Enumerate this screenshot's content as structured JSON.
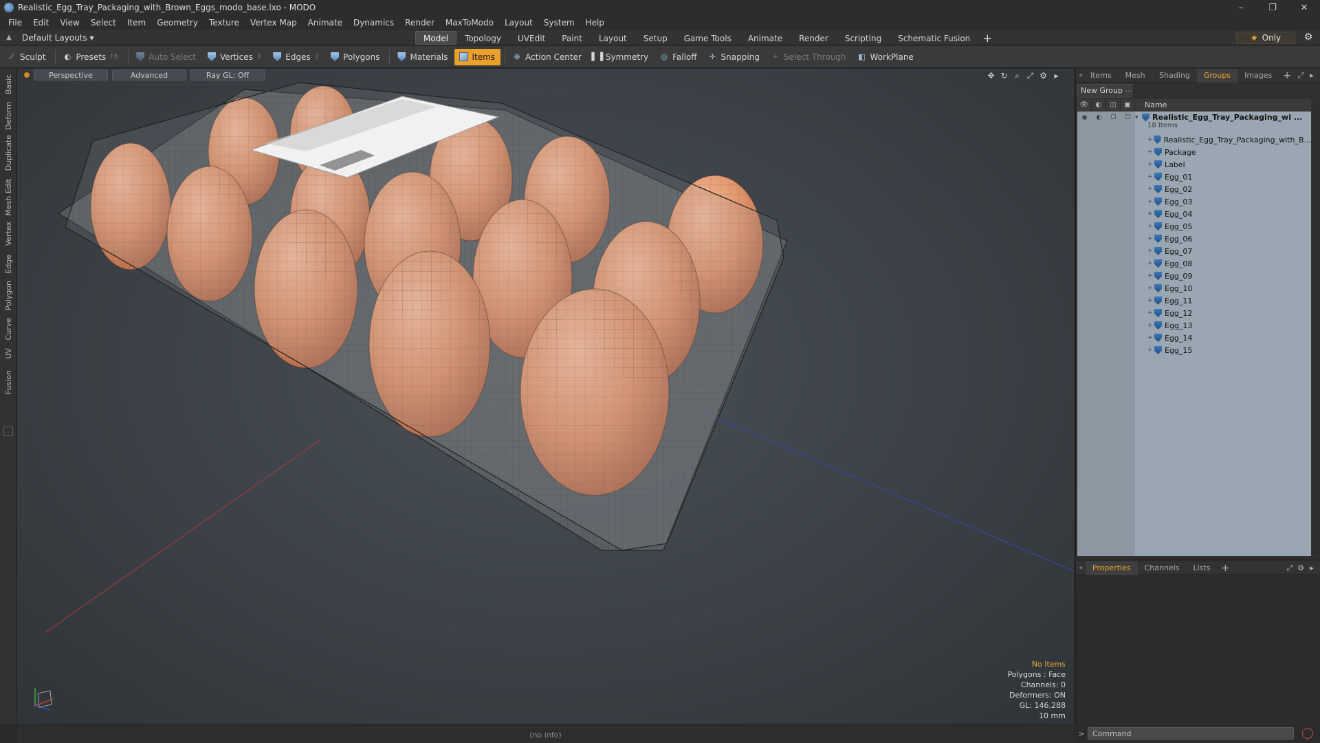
{
  "window": {
    "title": "Realistic_Egg_Tray_Packaging_with_Brown_Eggs_modo_base.lxo - MODO",
    "minimize": "–",
    "restore": "❐",
    "close": "✕"
  },
  "menu": [
    "File",
    "Edit",
    "View",
    "Select",
    "Item",
    "Geometry",
    "Texture",
    "Vertex Map",
    "Animate",
    "Dynamics",
    "Render",
    "MaxToModo",
    "Layout",
    "System",
    "Help"
  ],
  "layout_bar": {
    "layout_name": "Default Layouts ▾",
    "tabs": [
      "Model",
      "Topology",
      "UVEdit",
      "Paint",
      "Layout",
      "Setup",
      "Game Tools",
      "Animate",
      "Render",
      "Scripting",
      "Schematic Fusion"
    ],
    "active_tab": "Model",
    "add_tab": "+",
    "only_label": "Only"
  },
  "toolbar": {
    "sculpt": "Sculpt",
    "presets": "Presets",
    "presets_key": "F6",
    "auto_select": "Auto Select",
    "vertices": "Vertices",
    "vertices_key": "1",
    "edges": "Edges",
    "edges_key": "2",
    "polygons": "Polygons",
    "materials": "Materials",
    "items": "Items",
    "action_center": "Action Center",
    "symmetry": "Symmetry",
    "falloff": "Falloff",
    "snapping": "Snapping",
    "select_through": "Select Through",
    "workplane": "WorkPlane"
  },
  "left_tabs": [
    "Basic",
    "Deform",
    "Duplicate",
    "Mesh Edit",
    "Vertex",
    "Edge",
    "Polygon",
    "Curve",
    "UV",
    "Fusion"
  ],
  "viewport": {
    "view_mode": "Perspective",
    "shading": "Advanced",
    "raygl": "Ray GL: Off",
    "info": {
      "selection": "No Items",
      "polygons": "Polygons : Face",
      "channels": "Channels: 0",
      "deformers": "Deformers: ON",
      "gl": "GL: 146,288",
      "scale": "10 mm"
    }
  },
  "status_bar": "(no info)",
  "right_panel": {
    "top_tabs": [
      "Items",
      "Mesh ...",
      "Shading",
      "Groups",
      "Images"
    ],
    "active_top_tab": "Groups",
    "new_group": "New Group",
    "name_header": "Name",
    "root": {
      "name": "Realistic_Egg_Tray_Packaging_wi ...",
      "count": "18 Items"
    },
    "children": [
      "Realistic_Egg_Tray_Packaging_with_B...",
      "Package",
      "Label",
      "Egg_01",
      "Egg_02",
      "Egg_03",
      "Egg_04",
      "Egg_05",
      "Egg_06",
      "Egg_07",
      "Egg_08",
      "Egg_09",
      "Egg_10",
      "Egg_11",
      "Egg_12",
      "Egg_13",
      "Egg_14",
      "Egg_15"
    ],
    "bottom_tabs": [
      "Properties",
      "Channels",
      "Lists"
    ],
    "active_bottom_tab": "Properties",
    "command_placeholder": "Command",
    "command_prompt": ">"
  },
  "colors": {
    "accent": "#e9a12c",
    "egg": "#e0946c",
    "groups_bg": "#9aa6b1"
  }
}
